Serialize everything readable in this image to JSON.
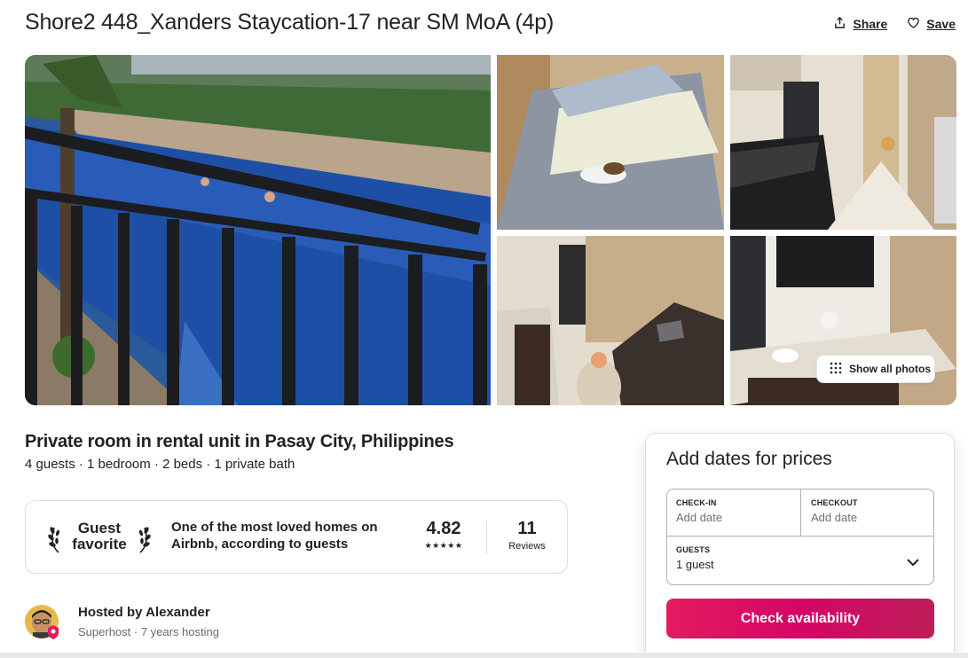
{
  "listing": {
    "title": "Shore2 448_Xanders Staycation-17 near SM MoA (4p)",
    "subtitle": "Private room in rental unit in Pasay City, Philippines",
    "details": "4 guests · 1 bedroom · 2 beds · 1 private bath"
  },
  "actions": {
    "share_label": "Share",
    "save_label": "Save"
  },
  "gallery": {
    "show_all_label": "Show all photos"
  },
  "guest_favorite": {
    "badge_line1": "Guest",
    "badge_line2": "favorite",
    "description": "One of the most loved homes on Airbnb, according to guests",
    "rating": "4.82",
    "stars": "★★★★★",
    "reviews_count": "11",
    "reviews_label": "Reviews"
  },
  "host": {
    "name": "Hosted by Alexander",
    "meta": "Superhost · 7 years hosting"
  },
  "booking": {
    "heading": "Add dates for prices",
    "checkin_label": "CHECK-IN",
    "checkin_value": "Add date",
    "checkout_label": "CHECKOUT",
    "checkout_value": "Add date",
    "guests_label": "GUESTS",
    "guests_value": "1 guest",
    "cta_label": "Check availability"
  },
  "colors": {
    "brand": "#e31c5f",
    "text": "#222222",
    "muted": "#6a6a6a",
    "border": "#dddddd"
  },
  "icons": [
    "share-icon",
    "heart-icon",
    "grid-icon",
    "laurel-left-icon",
    "laurel-right-icon",
    "chevron-down-icon",
    "superhost-badge-icon"
  ]
}
